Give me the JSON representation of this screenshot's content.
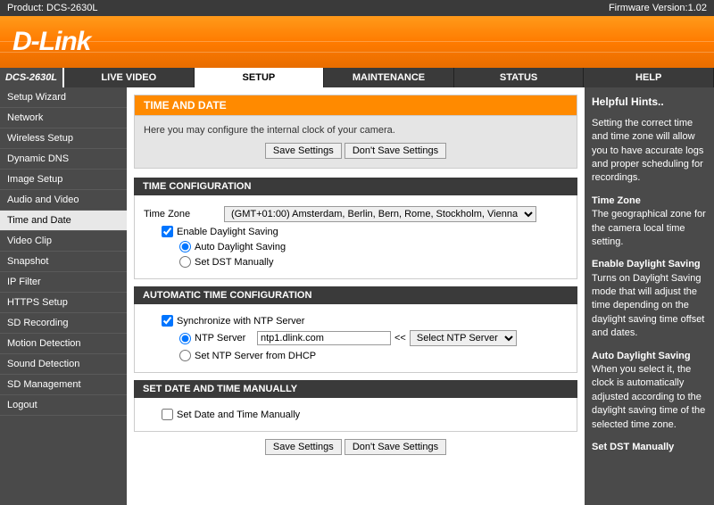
{
  "topbar": {
    "product_label": "Product: DCS-2630L",
    "firmware_label": "Firmware Version:1.02"
  },
  "logo": "D-Link",
  "model": "DCS-2630L",
  "tabs": [
    "LIVE VIDEO",
    "SETUP",
    "MAINTENANCE",
    "STATUS",
    "HELP"
  ],
  "active_tab": 1,
  "sidebar": {
    "items": [
      "Setup Wizard",
      "Network",
      "Wireless Setup",
      "Dynamic DNS",
      "Image Setup",
      "Audio and Video",
      "Time and Date",
      "Video Clip",
      "Snapshot",
      "IP Filter",
      "HTTPS Setup",
      "SD Recording",
      "Motion Detection",
      "Sound Detection",
      "SD Management",
      "Logout"
    ],
    "active": 6
  },
  "page": {
    "title": "TIME AND DATE",
    "intro": "Here you may configure the internal clock of your camera.",
    "save": "Save Settings",
    "dont_save": "Don't Save Settings",
    "section1": "TIME CONFIGURATION",
    "tz_label": "Time Zone",
    "tz_value": "(GMT+01:00) Amsterdam, Berlin, Bern, Rome, Stockholm, Vienna",
    "enable_dst": "Enable Daylight Saving",
    "auto_dst": "Auto Daylight Saving",
    "set_dst": "Set DST Manually",
    "section2": "AUTOMATIC TIME CONFIGURATION",
    "sync_ntp": "Synchronize with NTP Server",
    "ntp_label": "NTP Server",
    "ntp_value": "ntp1.dlink.com",
    "ntp_sel_label": "Select NTP Server",
    "ntp_dhcp": "Set NTP Server from DHCP",
    "section3": "SET DATE AND TIME MANUALLY",
    "manual": "Set Date and Time Manually",
    "arrows": "<<"
  },
  "hints": {
    "title": "Helpful Hints..",
    "p1": "Setting the correct time and time zone will allow you to have accurate logs and proper scheduling for recordings.",
    "h2": "Time Zone",
    "p2": "The geographical zone for the camera local time setting.",
    "h3": "Enable Daylight Saving",
    "p3": "Turns on Daylight Saving mode that will adjust the time depending on the daylight saving time offset and dates.",
    "h4": "Auto Daylight Saving",
    "p4": "When you select it, the clock is automatically adjusted according to the daylight saving time of the selected time zone.",
    "h5": "Set DST Manually"
  }
}
